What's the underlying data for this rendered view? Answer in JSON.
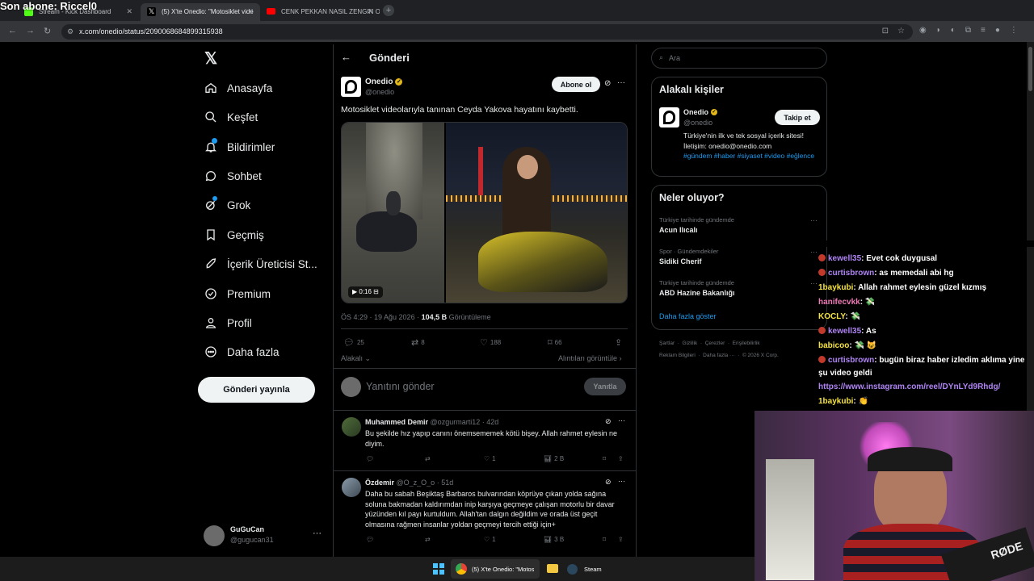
{
  "overlay": {
    "subscriber": "Son abone: Riccel0"
  },
  "browser": {
    "tabs": [
      {
        "label": "Stream - Kick Dashboard",
        "icon": "kick-icon",
        "color": "#53fc18"
      },
      {
        "label": "(5) X'te Onedio: \"Motosiklet vide",
        "icon": "x-icon",
        "color": "#000000"
      },
      {
        "label": "CENK PEKKAN NASIL ZENGIN O",
        "icon": "youtube-icon",
        "color": "#ff0000"
      }
    ],
    "url": "x.com/onedio/status/2090068684899315938"
  },
  "sidebar": {
    "items": [
      {
        "label": "Anasayfa",
        "icon": "home-icon"
      },
      {
        "label": "Keşfet",
        "icon": "search-icon"
      },
      {
        "label": "Bildirimler",
        "icon": "bell-icon"
      },
      {
        "label": "Sohbet",
        "icon": "chat-icon"
      },
      {
        "label": "Grok",
        "icon": "grok-icon"
      },
      {
        "label": "Geçmiş",
        "icon": "bookmark-icon"
      },
      {
        "label": "İçerik Üreticisi St...",
        "icon": "rocket-icon"
      },
      {
        "label": "Premium",
        "icon": "premium-icon"
      },
      {
        "label": "Profil",
        "icon": "profile-icon"
      },
      {
        "label": "Daha fazla",
        "icon": "more-circle-icon"
      }
    ],
    "post_button": "Gönderi yayınla",
    "account": {
      "name": "GuGuCan",
      "handle": "@gugucan31"
    }
  },
  "post": {
    "header": "Gönderi",
    "author": "Onedio",
    "handle": "@onedio",
    "follow": "Abone ol",
    "text": "Motosiklet videolarıyla tanınan Ceyda Yakova hayatını kaybetti.",
    "video_time": "0:16",
    "meta_time": "ÖS 4:29 · 19 Ağu 2026 ·",
    "views": "104,5 B",
    "views_label": "Görüntüleme",
    "replies": "25",
    "reposts": "8",
    "likes": "188",
    "bookmarks": "66",
    "relevant": "Alakalı",
    "quotes": "Alıntıları görüntüle",
    "reply_placeholder": "Yanıtını gönder",
    "reply_button": "Yanıtla"
  },
  "replies": [
    {
      "name": "Muhammed Demir",
      "handle": "@ozgurmarti12 · 42d",
      "text": "Bu şekilde hız yapıp canını önemsememek kötü bişey. Allah rahmet eylesin ne diyim.",
      "likes": "1",
      "views": "2 B"
    },
    {
      "name": "Özdemir",
      "handle": "@O_z_O_o · 51d",
      "text": "Daha bu sabah Beşiktaş Barbaros bulvarından köprüye çıkan yolda sağına soluna bakmadan kaldırımdan inip karşıya geçmeye çalışan motorlu bir davar yüzünden kıl payı kurtuldum. Allah'tan dalgın değildim ve orada üst geçit olmasına rağmen insanlar yoldan geçmeyi tercih ettiği için+",
      "likes": "1",
      "views": "3 B"
    }
  ],
  "right": {
    "search_placeholder": "Ara",
    "people_title": "Alakalı kişiler",
    "person": {
      "name": "Onedio",
      "handle": "@onedio",
      "follow": "Takip et",
      "bio": "Türkiye'nin ilk ve tek sosyal içerik sitesi! İletişim: onedio@onedio.com",
      "tags": "#gündem #haber #siyaset #video #eğlence"
    },
    "trends_title": "Neler oluyor?",
    "trends": [
      {
        "context": "Türkiye tarihinde gündemde",
        "name": "Acun Ilıcalı"
      },
      {
        "context": "Spor · Gündemdekiler",
        "name": "Sidiki Cherif"
      },
      {
        "context": "Türkiye tarihinde gündemde",
        "name": "ABD Hazine Bakanlığı"
      }
    ],
    "show_more": "Daha fazla göster",
    "footer1": "Şartlar  ·  Gizlilik  ·  Çerezler  ·  Erişilebilirlik",
    "footer2": "Reklam Bilgileri  ·  Daha fazla ···  ·  © 2026 X Corp."
  },
  "chat": [
    {
      "user": "kewell35",
      "color": "#b084f5",
      "badge": true,
      "msg": ": Evet cok duygusal"
    },
    {
      "user": "curtisbrown",
      "color": "#b084f5",
      "badge": true,
      "msg": ": as memedali abi hg"
    },
    {
      "user": "1baykubi",
      "color": "#f5e342",
      "badge": false,
      "msg": ": Allah rahmet eylesin güzel kızmış"
    },
    {
      "user": "hanifecvkk",
      "color": "#f07ab8",
      "badge": false,
      "msg": ": 💸"
    },
    {
      "user": "KOCLY",
      "color": "#f5e342",
      "badge": false,
      "msg": ": 💸"
    },
    {
      "user": "kewell35",
      "color": "#b084f5",
      "badge": true,
      "msg": ": As"
    },
    {
      "user": "babicoo",
      "color": "#f5e342",
      "badge": false,
      "msg": ": 💸 😺"
    },
    {
      "user": "curtisbrown",
      "color": "#b084f5",
      "badge": true,
      "msg": ": bugün biraz haber izledim aklıma yine"
    },
    {
      "user": "",
      "color": "#ffffff",
      "badge": false,
      "msg": "şu video geldi"
    },
    {
      "user": "",
      "color": "#b084f5",
      "badge": false,
      "msg": "https://www.instagram.com/reel/DYnLYd9Rhdg/"
    },
    {
      "user": "1baykubi",
      "color": "#f5e342",
      "badge": false,
      "msg": ": 👏"
    }
  ],
  "taskbar": {
    "chrome_label": "(5) X'te Onedio: \"Motos",
    "steam_label": "Steam"
  },
  "webcam": {
    "mic_label": "RØDE"
  }
}
